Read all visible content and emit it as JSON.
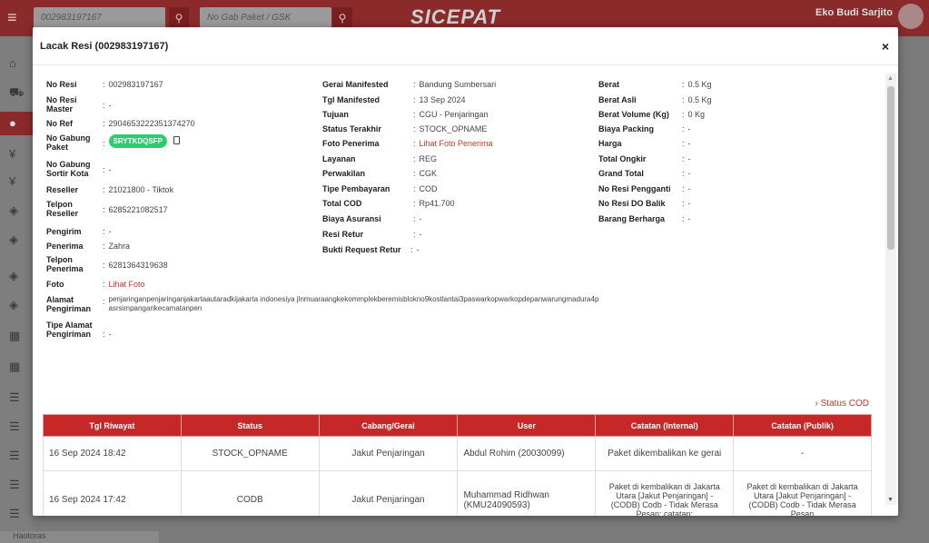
{
  "topbar": {
    "search_resi": "002983197167",
    "search_gabung_placeholder": "No Gab Paket / GSK",
    "logo": "SICEPAT",
    "user_name": "Eko Budi Sarjito"
  },
  "bottom_bar_label": "Haotoras",
  "modal": {
    "title": "Lacak Resi (002983197167)",
    "close": "×",
    "col1": [
      {
        "label": "No Resi",
        "value": "002983197167"
      },
      {
        "label": "No Resi Master",
        "value": "-"
      },
      {
        "label": "No Ref",
        "value": "2904653222351374270"
      },
      {
        "label": "No Gabung Paket",
        "value": "SRYTKDQSFP"
      },
      {
        "label": "No Gabung Sortir Kota",
        "value": "-"
      },
      {
        "label": "Reseller",
        "value": "21021800 - Tiktok"
      },
      {
        "label": "Telpon Reseller",
        "value": "6285221082517"
      },
      {
        "label": "Pengirim",
        "value": "-"
      },
      {
        "label": "Penerima",
        "value": "Zahra"
      },
      {
        "label": "Telpon Penerima",
        "value": "6281364319638"
      },
      {
        "label": "Foto",
        "value": "Lihat Foto"
      },
      {
        "label": "Alamat Pengiriman",
        "value": "penjaringanpenjaringanjakartaautaradkijakarta indonesiya jlnmuaraangkekommplekberemisblokno9kostlantai3paswarkopwarkopdepanwarungmadura4pasrsimpangankecamatanpen"
      },
      {
        "label": "Tipe Alamat Pengiriman",
        "value": "-"
      }
    ],
    "col2": [
      {
        "label": "Gerai Manifested",
        "value": "Bandung Sumbersari"
      },
      {
        "label": "Tgl Manifested",
        "value": "13 Sep 2024"
      },
      {
        "label": "Tujuan",
        "value": "CGU - Penjaringan"
      },
      {
        "label": "Status Terakhir",
        "value": "STOCK_OPNAME"
      },
      {
        "label": "Foto Penerima",
        "value": "Lihat Foto Penerima"
      },
      {
        "label": "Layanan",
        "value": "REG"
      },
      {
        "label": "Perwakilan",
        "value": "CGK"
      },
      {
        "label": "Tipe Pembayaran",
        "value": "COD"
      },
      {
        "label": "Total COD",
        "value": "Rp41.700"
      },
      {
        "label": "Biaya Asuransi",
        "value": "-"
      },
      {
        "label": "Resi Retur",
        "value": "-"
      },
      {
        "label": "Bukti Request Retur",
        "value": "-"
      }
    ],
    "col3": [
      {
        "label": "Berat",
        "value": "0.5 Kg"
      },
      {
        "label": "Berat Asli",
        "value": "0.5 Kg"
      },
      {
        "label": "Berat Volume (Kg)",
        "value": "0 Kg"
      },
      {
        "label": "Biaya Packing",
        "value": "-"
      },
      {
        "label": "Harga",
        "value": "-"
      },
      {
        "label": "Total Ongkir",
        "value": "-"
      },
      {
        "label": "Grand Total",
        "value": "-"
      },
      {
        "label": "No Resi Pengganti",
        "value": "-"
      },
      {
        "label": "No Resi DO Balik",
        "value": "-"
      },
      {
        "label": "Barang Berharga",
        "value": "-"
      }
    ],
    "status_cod_link": "› Status COD",
    "history": {
      "headers": [
        "Tgl Riwayat",
        "Status",
        "Cabang/Gerai",
        "User",
        "Catatan (Internal)",
        "Catatan (Publik)"
      ],
      "rows": [
        [
          "16 Sep 2024 18:42",
          "STOCK_OPNAME",
          "Jakut Penjaringan",
          "Abdul Rohim (20030099)",
          "Paket dikembalikan ke gerai",
          "-"
        ],
        [
          "16 Sep 2024 17:42",
          "CODB",
          "Jakut Penjaringan",
          "Muhammad Ridhwan (KMU24090593)",
          "Paket di kembalikan di Jakarta Utara [Jakut Penjaringan] - (CODB) Codb - Tidak Merasa Pesan; catatan:",
          "Paket di kembalikan di Jakarta Utara [Jakut Penjaringan] - (CODB) Codb - Tidak Merasa Pesan"
        ]
      ]
    }
  }
}
